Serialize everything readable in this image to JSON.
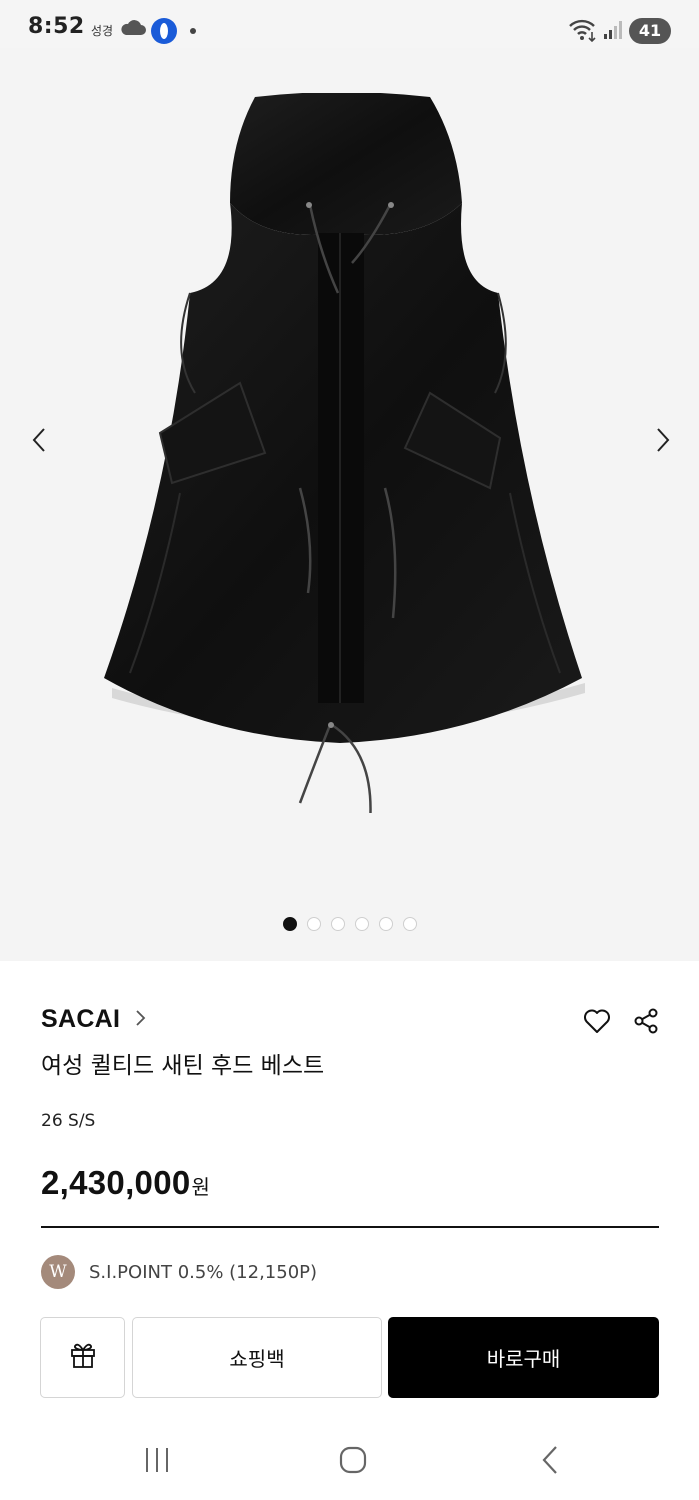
{
  "status_bar": {
    "time": "8:52",
    "carrier": "성경",
    "battery": "41",
    "icons": [
      "cloud-icon",
      "app-icon",
      "notification-dot",
      "wifi-icon",
      "signal-icon",
      "battery-icon"
    ]
  },
  "gallery": {
    "image_name": "hooded-vest-product-image",
    "page_count": 6,
    "active_index": 0,
    "prev_icon": "chevron-left-icon",
    "next_icon": "chevron-right-icon"
  },
  "product": {
    "brand": "SACAI",
    "name": "여성 퀼티드 새틴 후드 베스트",
    "season": "26 S/S",
    "price": "2,430,000",
    "currency": "원"
  },
  "point": {
    "badge": "W",
    "text": "S.I.POINT 0.5% (12,150P)"
  },
  "actions": {
    "gift_icon": "gift-icon",
    "bag_label": "쇼핑백",
    "buy_label": "바로구매"
  },
  "colors": {
    "background": "#ffffff",
    "gallery_bg": "#f4f4f4",
    "buy_button": "#000000",
    "point_badge": "#a48a7b"
  }
}
